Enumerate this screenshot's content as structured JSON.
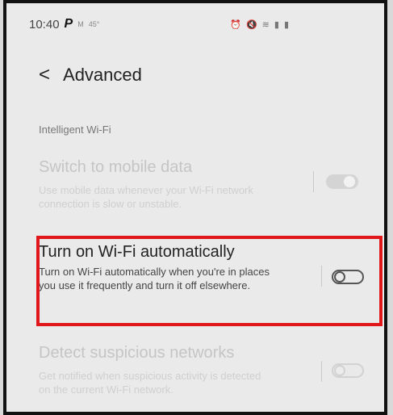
{
  "status_bar": {
    "time": "10:40",
    "icons_left": [
      "P",
      "M",
      "45°"
    ],
    "icons_right": [
      "alarm-icon",
      "mute-icon",
      "wifi-icon",
      "signal-icon",
      "battery-icon"
    ]
  },
  "header": {
    "back_icon": "chevron-left-icon",
    "title": "Advanced"
  },
  "section": {
    "title": "Intelligent Wi-Fi"
  },
  "settings": [
    {
      "title": "Switch to mobile data",
      "description": "Use mobile data whenever your Wi-Fi network connection is slow or unstable.",
      "state": "on",
      "enabled": false
    },
    {
      "title": "Turn on Wi-Fi automatically",
      "description": "Turn on Wi-Fi automatically when you're in places you use it frequently and turn it off elsewhere.",
      "state": "off",
      "enabled": true
    },
    {
      "title": "Detect suspicious networks",
      "description": "Get notified when suspicious activity is detected on the current Wi-Fi network.",
      "state": "off",
      "enabled": false
    }
  ],
  "colors": {
    "highlight": "#e0181b",
    "background": "#eaeaea"
  }
}
